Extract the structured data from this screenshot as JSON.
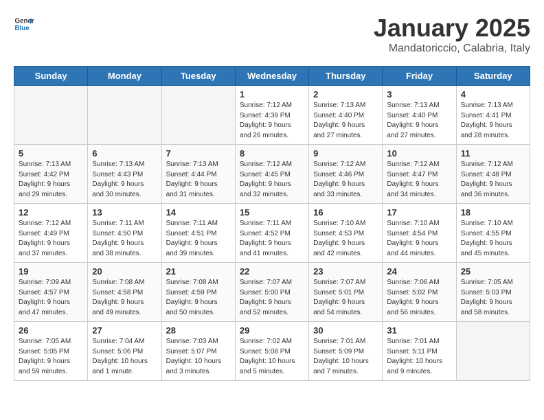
{
  "logo": {
    "general": "General",
    "blue": "Blue"
  },
  "header": {
    "title": "January 2025",
    "subtitle": "Mandatoriccio, Calabria, Italy"
  },
  "weekdays": [
    "Sunday",
    "Monday",
    "Tuesday",
    "Wednesday",
    "Thursday",
    "Friday",
    "Saturday"
  ],
  "weeks": [
    [
      {
        "day": "",
        "info": ""
      },
      {
        "day": "",
        "info": ""
      },
      {
        "day": "",
        "info": ""
      },
      {
        "day": "1",
        "info": "Sunrise: 7:12 AM\nSunset: 4:39 PM\nDaylight: 9 hours and 26 minutes."
      },
      {
        "day": "2",
        "info": "Sunrise: 7:13 AM\nSunset: 4:40 PM\nDaylight: 9 hours and 27 minutes."
      },
      {
        "day": "3",
        "info": "Sunrise: 7:13 AM\nSunset: 4:40 PM\nDaylight: 9 hours and 27 minutes."
      },
      {
        "day": "4",
        "info": "Sunrise: 7:13 AM\nSunset: 4:41 PM\nDaylight: 9 hours and 28 minutes."
      }
    ],
    [
      {
        "day": "5",
        "info": "Sunrise: 7:13 AM\nSunset: 4:42 PM\nDaylight: 9 hours and 29 minutes."
      },
      {
        "day": "6",
        "info": "Sunrise: 7:13 AM\nSunset: 4:43 PM\nDaylight: 9 hours and 30 minutes."
      },
      {
        "day": "7",
        "info": "Sunrise: 7:13 AM\nSunset: 4:44 PM\nDaylight: 9 hours and 31 minutes."
      },
      {
        "day": "8",
        "info": "Sunrise: 7:12 AM\nSunset: 4:45 PM\nDaylight: 9 hours and 32 minutes."
      },
      {
        "day": "9",
        "info": "Sunrise: 7:12 AM\nSunset: 4:46 PM\nDaylight: 9 hours and 33 minutes."
      },
      {
        "day": "10",
        "info": "Sunrise: 7:12 AM\nSunset: 4:47 PM\nDaylight: 9 hours and 34 minutes."
      },
      {
        "day": "11",
        "info": "Sunrise: 7:12 AM\nSunset: 4:48 PM\nDaylight: 9 hours and 36 minutes."
      }
    ],
    [
      {
        "day": "12",
        "info": "Sunrise: 7:12 AM\nSunset: 4:49 PM\nDaylight: 9 hours and 37 minutes."
      },
      {
        "day": "13",
        "info": "Sunrise: 7:11 AM\nSunset: 4:50 PM\nDaylight: 9 hours and 38 minutes."
      },
      {
        "day": "14",
        "info": "Sunrise: 7:11 AM\nSunset: 4:51 PM\nDaylight: 9 hours and 39 minutes."
      },
      {
        "day": "15",
        "info": "Sunrise: 7:11 AM\nSunset: 4:52 PM\nDaylight: 9 hours and 41 minutes."
      },
      {
        "day": "16",
        "info": "Sunrise: 7:10 AM\nSunset: 4:53 PM\nDaylight: 9 hours and 42 minutes."
      },
      {
        "day": "17",
        "info": "Sunrise: 7:10 AM\nSunset: 4:54 PM\nDaylight: 9 hours and 44 minutes."
      },
      {
        "day": "18",
        "info": "Sunrise: 7:10 AM\nSunset: 4:55 PM\nDaylight: 9 hours and 45 minutes."
      }
    ],
    [
      {
        "day": "19",
        "info": "Sunrise: 7:09 AM\nSunset: 4:57 PM\nDaylight: 9 hours and 47 minutes."
      },
      {
        "day": "20",
        "info": "Sunrise: 7:08 AM\nSunset: 4:58 PM\nDaylight: 9 hours and 49 minutes."
      },
      {
        "day": "21",
        "info": "Sunrise: 7:08 AM\nSunset: 4:59 PM\nDaylight: 9 hours and 50 minutes."
      },
      {
        "day": "22",
        "info": "Sunrise: 7:07 AM\nSunset: 5:00 PM\nDaylight: 9 hours and 52 minutes."
      },
      {
        "day": "23",
        "info": "Sunrise: 7:07 AM\nSunset: 5:01 PM\nDaylight: 9 hours and 54 minutes."
      },
      {
        "day": "24",
        "info": "Sunrise: 7:06 AM\nSunset: 5:02 PM\nDaylight: 9 hours and 56 minutes."
      },
      {
        "day": "25",
        "info": "Sunrise: 7:05 AM\nSunset: 5:03 PM\nDaylight: 9 hours and 58 minutes."
      }
    ],
    [
      {
        "day": "26",
        "info": "Sunrise: 7:05 AM\nSunset: 5:05 PM\nDaylight: 9 hours and 59 minutes."
      },
      {
        "day": "27",
        "info": "Sunrise: 7:04 AM\nSunset: 5:06 PM\nDaylight: 10 hours and 1 minute."
      },
      {
        "day": "28",
        "info": "Sunrise: 7:03 AM\nSunset: 5:07 PM\nDaylight: 10 hours and 3 minutes."
      },
      {
        "day": "29",
        "info": "Sunrise: 7:02 AM\nSunset: 5:08 PM\nDaylight: 10 hours and 5 minutes."
      },
      {
        "day": "30",
        "info": "Sunrise: 7:01 AM\nSunset: 5:09 PM\nDaylight: 10 hours and 7 minutes."
      },
      {
        "day": "31",
        "info": "Sunrise: 7:01 AM\nSunset: 5:11 PM\nDaylight: 10 hours and 9 minutes."
      },
      {
        "day": "",
        "info": ""
      }
    ]
  ]
}
